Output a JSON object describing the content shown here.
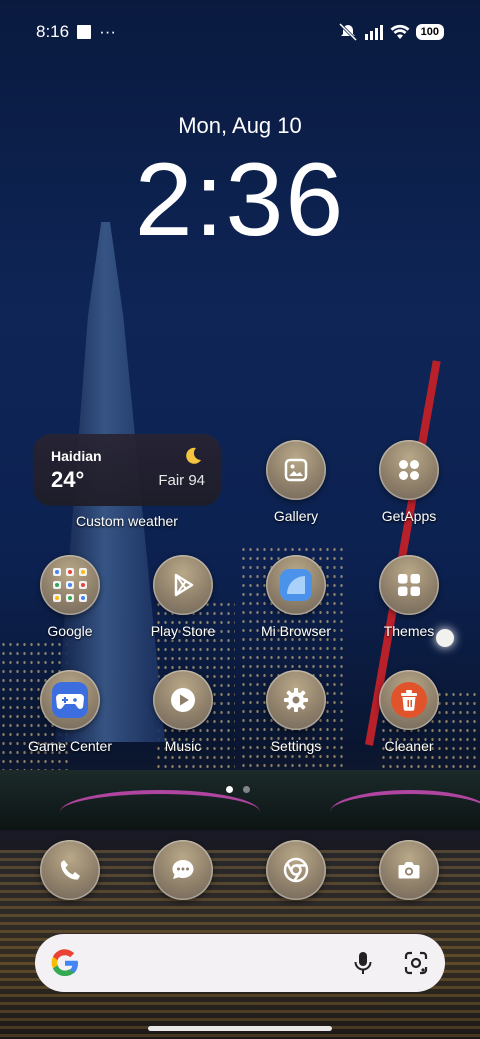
{
  "status_bar": {
    "time": "8:16",
    "more": "···",
    "battery": "100"
  },
  "lockclock": {
    "date": "Mon, Aug 10",
    "time": "2:36"
  },
  "weather": {
    "city": "Haidian",
    "temp": "24°",
    "condition": "Fair 94",
    "label": "Custom weather"
  },
  "apps": [
    {
      "label": "Gallery"
    },
    {
      "label": "GetApps"
    },
    {
      "label": "Google"
    },
    {
      "label": "Play Store"
    },
    {
      "label": "Mi Browser"
    },
    {
      "label": "Themes"
    },
    {
      "label": "Game Center"
    },
    {
      "label": "Music"
    },
    {
      "label": "Settings"
    },
    {
      "label": "Cleaner"
    }
  ],
  "dock": [
    {
      "icon": "phone-icon"
    },
    {
      "icon": "messages-icon"
    },
    {
      "icon": "chrome-icon"
    },
    {
      "icon": "camera-icon"
    }
  ],
  "page_indicator": {
    "pages": 2,
    "active": 1
  },
  "colors": {
    "cleaner": "#e0532b",
    "browser": "#3d8ae6",
    "game": "#3c6ee0"
  }
}
